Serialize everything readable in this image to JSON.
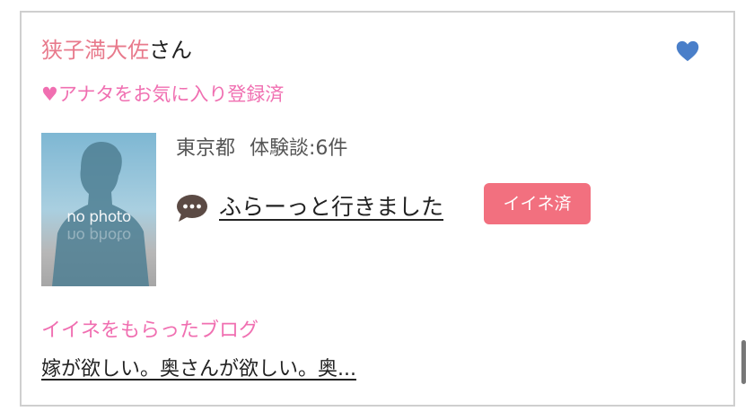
{
  "user": {
    "name": "狭子満大佐",
    "suffix": "さん",
    "favorite_status": "♥アナタをお気に入り登録済",
    "avatar_placeholder_text": "no photo"
  },
  "profile": {
    "location": "東京都",
    "reviews": "体験談:6件"
  },
  "latest_review": {
    "title": "ふらーっと行きました",
    "like_badge": "イイネ済"
  },
  "liked_blog": {
    "heading": "イイネをもらったブログ",
    "title": "嫁が欲しい。奥さんが欲しい。奥..."
  },
  "colors": {
    "name_pink": "#e87a8c",
    "accent_pink": "#f06fb1",
    "badge_red": "#f2707f",
    "heart_blue": "#4a7fc9"
  },
  "icons": {
    "favorite": "heart-icon",
    "comment": "speech-bubble-icon"
  }
}
